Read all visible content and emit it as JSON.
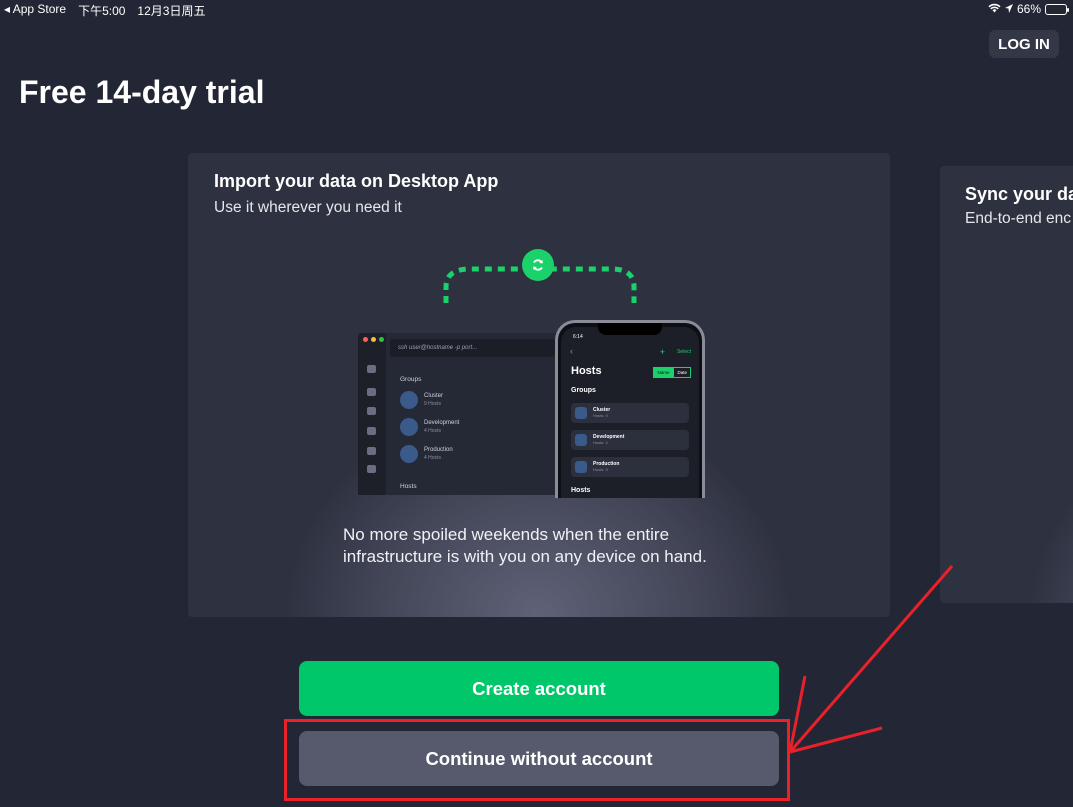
{
  "status_bar": {
    "back_app": "◂ App Store",
    "time": "下午5:00",
    "date": "12月3日周五",
    "battery": "66%",
    "battery_level": 0.66
  },
  "header": {
    "login_label": "LOG IN",
    "title": "Free 14-day trial"
  },
  "card_main": {
    "title": "Import your data on Desktop App",
    "subtitle": "Use it wherever you need it",
    "description": "No more spoiled weekends when the entire infrastructure is with you on any device on hand.",
    "illustration": {
      "desktop": {
        "command": "ssh user@hostname -p port...",
        "groups_heading": "Groups",
        "hosts_heading": "Hosts",
        "groups": [
          {
            "name": "Cluster",
            "meta": "9 Hosts"
          },
          {
            "name": "Development",
            "meta": "4 Hosts"
          },
          {
            "name": "Production",
            "meta": "4 Hosts"
          }
        ]
      },
      "phone": {
        "time": "6:14",
        "select_label": "Select",
        "title": "Hosts",
        "sort_name": "Name",
        "sort_date": "Date",
        "groups_heading": "Groups",
        "hosts_heading": "Hosts",
        "groups": [
          {
            "name": "Cluster",
            "meta": "Hosts: 9"
          },
          {
            "name": "Development",
            "meta": "Hosts: 4"
          },
          {
            "name": "Production",
            "meta": "Hosts: 3"
          }
        ]
      }
    }
  },
  "card_next": {
    "title": "Sync your dat",
    "subtitle": "End-to-end enc"
  },
  "buttons": {
    "create": "Create account",
    "continue": "Continue without account"
  },
  "colors": {
    "background": "#232634",
    "accent": "#00c76a",
    "annotation": "#e8212a"
  }
}
